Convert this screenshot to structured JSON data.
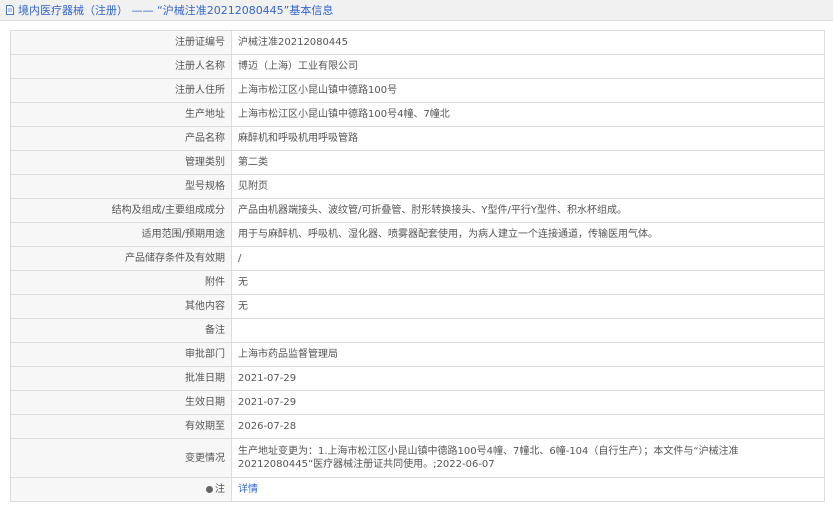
{
  "header": {
    "title_prefix": "境内医疗器械（注册）",
    "title_separator": "——",
    "title_suffix": "“沪械注准20212080445”基本信息"
  },
  "rows": [
    {
      "label": "注册证编号",
      "value": "沪械注准20212080445"
    },
    {
      "label": "注册人名称",
      "value": "博迈（上海）工业有限公司"
    },
    {
      "label": "注册人住所",
      "value": "上海市松江区小昆山镇中德路100号"
    },
    {
      "label": "生产地址",
      "value": "上海市松江区小昆山镇中德路100号4幢、7幢北"
    },
    {
      "label": "产品名称",
      "value": "麻醉机和呼吸机用呼吸管路"
    },
    {
      "label": "管理类别",
      "value": "第二类"
    },
    {
      "label": "型号规格",
      "value": "见附页"
    },
    {
      "label": "结构及组成/主要组成成分",
      "value": "产品由机器端接头、波纹管/可折叠管、肘形转换接头、Y型件/平行Y型件、积水杯组成。"
    },
    {
      "label": "适用范围/预期用途",
      "value": "用于与麻醉机、呼吸机、湿化器、喷雾器配套使用，为病人建立一个连接通道，传输医用气体。"
    },
    {
      "label": "产品储存条件及有效期",
      "value": "/"
    },
    {
      "label": "附件",
      "value": "无"
    },
    {
      "label": "其他内容",
      "value": "无"
    },
    {
      "label": "备注",
      "value": ""
    },
    {
      "label": "审批部门",
      "value": "上海市药品监督管理局"
    },
    {
      "label": "批准日期",
      "value": "2021-07-29"
    },
    {
      "label": "生效日期",
      "value": "2021-07-29"
    },
    {
      "label": "有效期至",
      "value": "2026-07-28"
    },
    {
      "label": "变更情况",
      "value": "生产地址变更为：1.上海市松江区小昆山镇中德路100号4幢、7幢北、6幢-104（自行生产）；本文件与“沪械注准20212080445”医疗器械注册证共同使用。;2022-06-07"
    }
  ],
  "note_row": {
    "label": "注",
    "link_text": "详情"
  },
  "colors": {
    "link": "#3366cc",
    "label_bg": "#f7f7f7",
    "border": "#dcdcdc",
    "topbar_bg": "#f1f1f1"
  },
  "icons": {
    "header": "document-icon",
    "note": "note-dot-icon"
  }
}
